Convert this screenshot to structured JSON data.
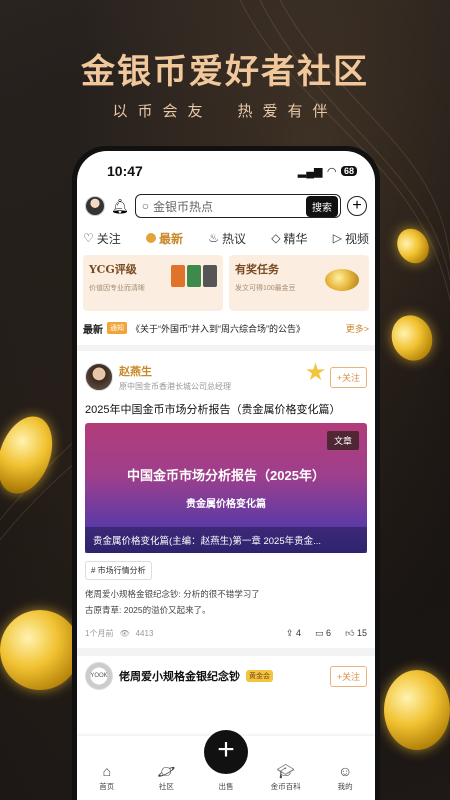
{
  "hero": {
    "title": "金银币爱好者社区",
    "subtitle": "以币会友　热爱有伴"
  },
  "status": {
    "time": "10:47",
    "battery": "68"
  },
  "search": {
    "placeholder": "金银币热点",
    "button": "搜索"
  },
  "tabs": [
    {
      "label": "关注",
      "icon": "heart-icon"
    },
    {
      "label": "最新",
      "icon": "dot-icon",
      "active": true
    },
    {
      "label": "热议",
      "icon": "flame-icon"
    },
    {
      "label": "精华",
      "icon": "diamond-icon"
    },
    {
      "label": "视频",
      "icon": "play-icon"
    }
  ],
  "cards": [
    {
      "title": "YCG评级",
      "subtitle": "价值因专业而清晰"
    },
    {
      "title": "有奖任务",
      "subtitle": "发文可得100最金豆"
    }
  ],
  "notice": {
    "label": "最新",
    "tag": "通知",
    "text": "《关于“外国币”并入到“周六综合场”的公告》",
    "more": "更多>"
  },
  "post1": {
    "author": "赵燕生",
    "role": "原中国金币香港长城公司总经理",
    "follow": "+关注",
    "title": "2025年中国金币市场分析报告（贵金属价格变化篇）",
    "badge": "文章",
    "banner_title": "中国金币市场分析报告（2025年）",
    "banner_sub": "贵金属价格变化篇",
    "banner_footer": "贵金属价格变化篇(主编：赵燕生)第一章 2025年贵金...",
    "topic": "# 市场行情分析",
    "comments": [
      "佬周爱小规格金银纪念钞: 分析的很不错学习了",
      "古原青草: 2025的溢价又起来了。"
    ],
    "time": "1个月前",
    "views": "4413",
    "shares": "4",
    "comment_count": "6",
    "likes": "15"
  },
  "post2": {
    "author": "佬周爱小规格金银纪念钞",
    "medal": "黄金会",
    "follow": "+关注",
    "avatar_text": "YOOK"
  },
  "nav": [
    {
      "label": "首页",
      "icon": "home-icon"
    },
    {
      "label": "社区",
      "icon": "planet-icon"
    },
    {
      "label": "出售",
      "icon": "plus-icon"
    },
    {
      "label": "金币百科",
      "icon": "graduation-cap-icon"
    },
    {
      "label": "我的",
      "icon": "profile-icon"
    }
  ]
}
